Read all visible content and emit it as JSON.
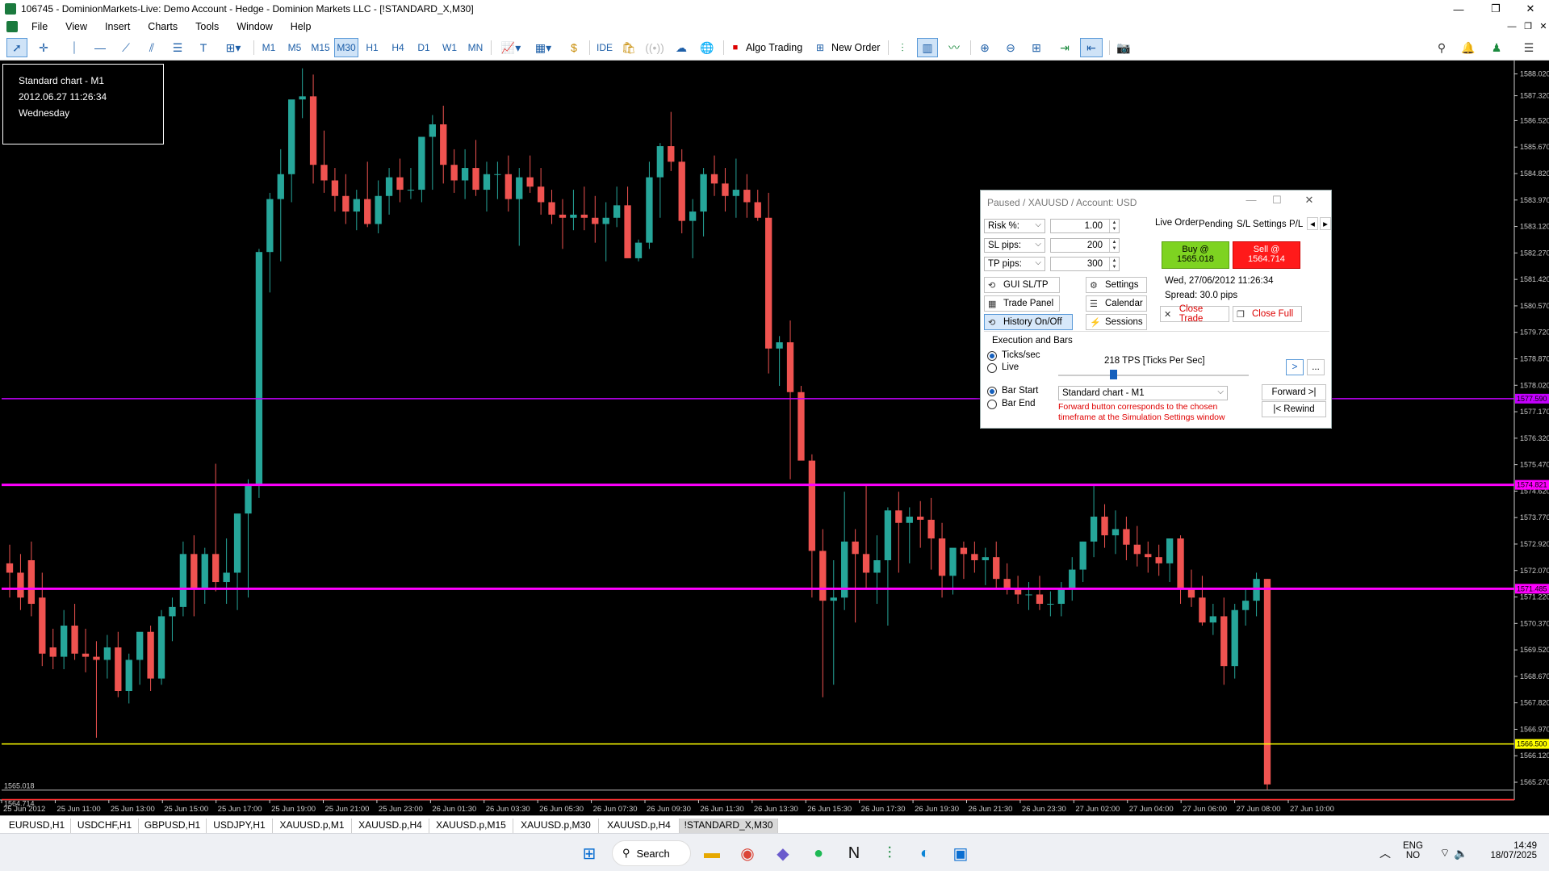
{
  "window": {
    "title": "106745 - DominionMarkets-Live: Demo Account - Hedge - Dominion Markets LLC - [!STANDARD_X,M30]",
    "minimize": "—",
    "restore": "❐",
    "close": "✕"
  },
  "menu": [
    "File",
    "View",
    "Insert",
    "Charts",
    "Tools",
    "Window",
    "Help"
  ],
  "toolbar": {
    "timeframes": [
      "M1",
      "M5",
      "M15",
      "M30",
      "H1",
      "H4",
      "D1",
      "W1",
      "MN"
    ],
    "active_timeframe": "M30",
    "ide_label": "IDE",
    "algo_trading_label": "Algo Trading",
    "new_order_label": "New Order"
  },
  "info_box": {
    "line1": "Standard chart - M1",
    "line2": "2012.06.27 11:26:34",
    "line3": "Wednesday"
  },
  "chart_data": {
    "type": "candlestick",
    "symbol": "XAUUSD",
    "timeframe": "M30",
    "y_ticks": [
      "1588.020",
      "1587.320",
      "1586.520",
      "1585.670",
      "1584.820",
      "1583.970",
      "1583.120",
      "1582.270",
      "1581.420",
      "1580.570",
      "1579.720",
      "1578.870",
      "1578.020",
      "1577.170",
      "1576.320",
      "1575.470",
      "1574.620",
      "1573.770",
      "1572.920",
      "1572.070",
      "1571.220",
      "1570.370",
      "1569.520",
      "1568.670",
      "1567.820",
      "1566.970",
      "1566.120",
      "1565.270"
    ],
    "ylim": [
      1564.7,
      1588.45
    ],
    "x_ticks": [
      "25 Jun 2012",
      "25 Jun 11:00",
      "25 Jun 13:00",
      "25 Jun 15:00",
      "25 Jun 17:00",
      "25 Jun 19:00",
      "25 Jun 21:00",
      "25 Jun 23:00",
      "26 Jun 01:30",
      "26 Jun 03:30",
      "26 Jun 05:30",
      "26 Jun 07:30",
      "26 Jun 09:30",
      "26 Jun 11:30",
      "26 Jun 13:30",
      "26 Jun 15:30",
      "26 Jun 17:30",
      "26 Jun 19:30",
      "26 Jun 21:30",
      "26 Jun 23:30",
      "27 Jun 02:00",
      "27 Jun 04:00",
      "27 Jun 06:00",
      "27 Jun 08:00",
      "27 Jun 10:00"
    ],
    "candles": [
      [
        1572.3,
        1572.9,
        1571.2,
        1572.0
      ],
      [
        1572.0,
        1572.6,
        1570.8,
        1571.2
      ],
      [
        1572.4,
        1573.0,
        1570.6,
        1571.0
      ],
      [
        1571.2,
        1572.0,
        1569.0,
        1569.4
      ],
      [
        1569.6,
        1570.2,
        1568.9,
        1569.3
      ],
      [
        1569.3,
        1570.8,
        1568.9,
        1570.3
      ],
      [
        1570.3,
        1571.0,
        1569.2,
        1569.4
      ],
      [
        1569.4,
        1570.2,
        1568.8,
        1569.3
      ],
      [
        1569.3,
        1569.8,
        1566.7,
        1569.2
      ],
      [
        1569.2,
        1570.0,
        1568.6,
        1569.6
      ],
      [
        1569.6,
        1570.1,
        1568.0,
        1568.2
      ],
      [
        1568.2,
        1569.4,
        1567.8,
        1569.2
      ],
      [
        1569.2,
        1569.9,
        1568.4,
        1570.1
      ],
      [
        1570.1,
        1570.3,
        1568.2,
        1568.6
      ],
      [
        1568.6,
        1570.8,
        1568.4,
        1570.6
      ],
      [
        1570.6,
        1571.2,
        1569.8,
        1570.9
      ],
      [
        1570.9,
        1573.0,
        1570.6,
        1572.6
      ],
      [
        1572.6,
        1573.2,
        1570.6,
        1571.5
      ],
      [
        1571.5,
        1572.8,
        1571.0,
        1572.6
      ],
      [
        1572.6,
        1575.5,
        1571.4,
        1571.7
      ],
      [
        1571.7,
        1573.1,
        1571.0,
        1572.0
      ],
      [
        1572.0,
        1573.2,
        1570.8,
        1573.9
      ],
      [
        1573.9,
        1575.0,
        1571.2,
        1574.8
      ],
      [
        1574.8,
        1582.4,
        1574.4,
        1582.3
      ],
      [
        1582.3,
        1584.2,
        1581.0,
        1584.0
      ],
      [
        1584.0,
        1585.6,
        1582.0,
        1584.8
      ],
      [
        1584.8,
        1587.1,
        1583.9,
        1587.2
      ],
      [
        1587.2,
        1588.2,
        1586.6,
        1587.3
      ],
      [
        1587.3,
        1588.0,
        1584.5,
        1585.1
      ],
      [
        1585.1,
        1586.2,
        1584.2,
        1584.6
      ],
      [
        1584.6,
        1585.0,
        1583.6,
        1584.1
      ],
      [
        1584.1,
        1584.8,
        1583.2,
        1583.6
      ],
      [
        1583.6,
        1584.3,
        1583.0,
        1584.0
      ],
      [
        1584.0,
        1585.2,
        1583.1,
        1583.2
      ],
      [
        1583.2,
        1584.6,
        1582.9,
        1584.1
      ],
      [
        1584.1,
        1585.0,
        1583.5,
        1584.7
      ],
      [
        1584.7,
        1585.3,
        1583.9,
        1584.3
      ],
      [
        1584.3,
        1585.0,
        1584.0,
        1584.3
      ],
      [
        1584.3,
        1586.0,
        1583.9,
        1586.0
      ],
      [
        1586.0,
        1586.7,
        1584.3,
        1586.4
      ],
      [
        1586.4,
        1587.0,
        1584.5,
        1585.1
      ],
      [
        1585.1,
        1585.6,
        1584.2,
        1584.6
      ],
      [
        1584.6,
        1585.6,
        1584.0,
        1585.0
      ],
      [
        1585.0,
        1585.9,
        1584.1,
        1584.3
      ],
      [
        1584.3,
        1585.2,
        1583.6,
        1584.8
      ],
      [
        1584.8,
        1585.2,
        1584.0,
        1584.8
      ],
      [
        1584.8,
        1585.4,
        1583.6,
        1584.0
      ],
      [
        1584.0,
        1585.0,
        1582.5,
        1584.7
      ],
      [
        1584.7,
        1585.4,
        1584.2,
        1584.4
      ],
      [
        1584.4,
        1585.0,
        1583.5,
        1583.9
      ],
      [
        1583.9,
        1584.3,
        1583.2,
        1583.5
      ],
      [
        1583.5,
        1584.0,
        1582.4,
        1583.4
      ],
      [
        1583.4,
        1584.3,
        1583.0,
        1583.5
      ],
      [
        1583.5,
        1584.4,
        1583.0,
        1583.4
      ],
      [
        1583.4,
        1584.1,
        1582.6,
        1583.2
      ],
      [
        1583.2,
        1583.9,
        1582.0,
        1583.4
      ],
      [
        1583.4,
        1584.4,
        1583.1,
        1583.8
      ],
      [
        1583.8,
        1584.4,
        1582.7,
        1582.1
      ],
      [
        1582.1,
        1582.7,
        1582.0,
        1582.6
      ],
      [
        1582.6,
        1585.2,
        1582.4,
        1584.7
      ],
      [
        1584.7,
        1585.8,
        1583.4,
        1585.7
      ],
      [
        1585.7,
        1586.8,
        1584.9,
        1585.2
      ],
      [
        1585.2,
        1585.6,
        1582.9,
        1583.3
      ],
      [
        1583.3,
        1584.0,
        1582.1,
        1583.6
      ],
      [
        1583.6,
        1585.0,
        1582.8,
        1584.8
      ],
      [
        1584.8,
        1585.4,
        1584.1,
        1584.5
      ],
      [
        1584.5,
        1585.0,
        1583.6,
        1584.1
      ],
      [
        1584.1,
        1585.3,
        1583.4,
        1584.3
      ],
      [
        1584.3,
        1584.8,
        1583.4,
        1583.9
      ],
      [
        1583.9,
        1584.3,
        1583.3,
        1583.4
      ],
      [
        1583.4,
        1584.2,
        1578.4,
        1579.2
      ],
      [
        1579.2,
        1579.6,
        1578.0,
        1579.4
      ],
      [
        1579.4,
        1580.1,
        1575.0,
        1577.8
      ],
      [
        1577.8,
        1578.0,
        1576.0,
        1575.6
      ],
      [
        1575.6,
        1575.8,
        1571.2,
        1572.7
      ],
      [
        1572.7,
        1573.4,
        1568.0,
        1571.1
      ],
      [
        1571.1,
        1572.4,
        1568.4,
        1571.2
      ],
      [
        1571.2,
        1574.6,
        1570.8,
        1573.0
      ],
      [
        1573.0,
        1573.4,
        1570.4,
        1572.6
      ],
      [
        1572.6,
        1574.8,
        1571.5,
        1572.0
      ],
      [
        1572.0,
        1573.2,
        1571.0,
        1572.4
      ],
      [
        1572.4,
        1574.1,
        1570.3,
        1574.0
      ],
      [
        1574.0,
        1574.6,
        1572.0,
        1573.6
      ],
      [
        1573.6,
        1574.1,
        1572.3,
        1573.8
      ],
      [
        1573.8,
        1574.3,
        1572.8,
        1573.7
      ],
      [
        1573.7,
        1574.4,
        1572.1,
        1573.1
      ],
      [
        1573.1,
        1573.6,
        1571.2,
        1571.9
      ],
      [
        1571.9,
        1572.7,
        1571.3,
        1572.8
      ],
      [
        1572.8,
        1573.0,
        1571.8,
        1572.6
      ],
      [
        1572.6,
        1573.0,
        1572.0,
        1572.4
      ],
      [
        1572.4,
        1572.8,
        1571.6,
        1572.5
      ],
      [
        1572.5,
        1573.0,
        1571.5,
        1571.8
      ],
      [
        1571.8,
        1572.3,
        1571.3,
        1571.5
      ],
      [
        1571.5,
        1571.9,
        1571.0,
        1571.3
      ],
      [
        1571.3,
        1571.7,
        1570.8,
        1571.3
      ],
      [
        1571.3,
        1571.9,
        1570.8,
        1571.0
      ],
      [
        1571.0,
        1571.4,
        1570.6,
        1571.0
      ],
      [
        1571.0,
        1571.7,
        1570.6,
        1571.5
      ],
      [
        1571.5,
        1572.5,
        1571.1,
        1572.1
      ],
      [
        1572.1,
        1573.0,
        1571.7,
        1573.0
      ],
      [
        1573.0,
        1574.8,
        1572.5,
        1573.8
      ],
      [
        1573.8,
        1574.2,
        1572.8,
        1573.2
      ],
      [
        1573.2,
        1574.0,
        1572.6,
        1573.4
      ],
      [
        1573.4,
        1573.8,
        1572.4,
        1572.9
      ],
      [
        1572.9,
        1573.5,
        1572.2,
        1572.6
      ],
      [
        1572.6,
        1573.0,
        1572.0,
        1572.5
      ],
      [
        1572.5,
        1572.9,
        1571.9,
        1572.3
      ],
      [
        1572.3,
        1573.1,
        1571.7,
        1573.1
      ],
      [
        1573.1,
        1573.2,
        1571.0,
        1571.5
      ],
      [
        1571.5,
        1572.1,
        1570.9,
        1571.2
      ],
      [
        1571.2,
        1571.9,
        1570.3,
        1570.4
      ],
      [
        1570.4,
        1571.0,
        1570.0,
        1570.6
      ],
      [
        1570.6,
        1571.2,
        1568.4,
        1569.0
      ],
      [
        1569.0,
        1571.0,
        1568.6,
        1570.8
      ],
      [
        1570.8,
        1571.5,
        1570.3,
        1571.1
      ],
      [
        1571.1,
        1572.0,
        1570.6,
        1571.8
      ],
      [
        1571.8,
        1571.8,
        1565.0,
        1565.2
      ]
    ],
    "hlines": [
      {
        "price": 1577.59,
        "color": "#c400ff",
        "label": "1577.590"
      },
      {
        "price": 1574.821,
        "color": "#ff00ff",
        "label": "1574.821"
      },
      {
        "price": 1571.485,
        "color": "#ff00ff",
        "label": "1571.485"
      },
      {
        "price": 1566.5,
        "color": "#ffff00",
        "label": "1566.500"
      },
      {
        "price": 1565.018,
        "color": "#808080",
        "label": ""
      },
      {
        "price": 1564.714,
        "color": "#ff3030",
        "label": ""
      }
    ],
    "bid_label": "1565.018",
    "ask_label": "1564.714",
    "bull_color": "#26a69a",
    "bear_color": "#ef5350"
  },
  "sim_panel": {
    "title": "Paused / XAUUSD / Account: USD",
    "risk_label": "Risk %:",
    "risk_value": "1.00",
    "sl_label": "SL pips:",
    "sl_value": "200",
    "tp_label": "TP pips:",
    "tp_value": "300",
    "gui_sltp": "GUI SL/TP",
    "trade_panel": "Trade Panel",
    "history": "History On/Off",
    "settings": "Settings",
    "calendar": "Calendar",
    "sessions": "Sessions",
    "tabs": [
      "Live Order",
      "Pending",
      "S/L Settings",
      "P/L"
    ],
    "buy_label": "Buy @",
    "buy_price": "1565.018",
    "sell_label": "Sell @",
    "sell_price": "1564.714",
    "datetime": "Wed, 27/06/2012  11:26:34",
    "spread": "Spread: 30.0 pips",
    "close_trade": "Close Trade",
    "close_full": "Close Full",
    "exec_title": "Execution and Bars",
    "ticks_sec": "Ticks/sec",
    "live": "Live",
    "tps": "218 TPS [Ticks Per Sec]",
    "tps_slider_fraction": 0.29,
    "next_btn": ">",
    "more_btn": "...",
    "bar_start": "Bar Start",
    "bar_end": "Bar End",
    "chart_select": "Standard chart - M1",
    "forward": "Forward >|",
    "rewind": "|< Rewind",
    "forward_note": "Forward button corresponds to the chosen timeframe at the Simulation Settings window"
  },
  "chart_tabs": [
    "EURUSD,H1",
    "USDCHF,H1",
    "GBPUSD,H1",
    "USDJPY,H1",
    "XAUUSD.p,M1",
    "XAUUSD.p,H4",
    "XAUUSD.p,M15",
    "XAUUSD.p,M30",
    "XAUUSD.p,H4",
    "!STANDARD_X,M30"
  ],
  "active_chart_tab": "!STANDARD_X,M30",
  "taskbar": {
    "search": "Search",
    "lang1": "ENG",
    "lang2": "NO",
    "time": "14:49",
    "date": "18/07/2025"
  }
}
